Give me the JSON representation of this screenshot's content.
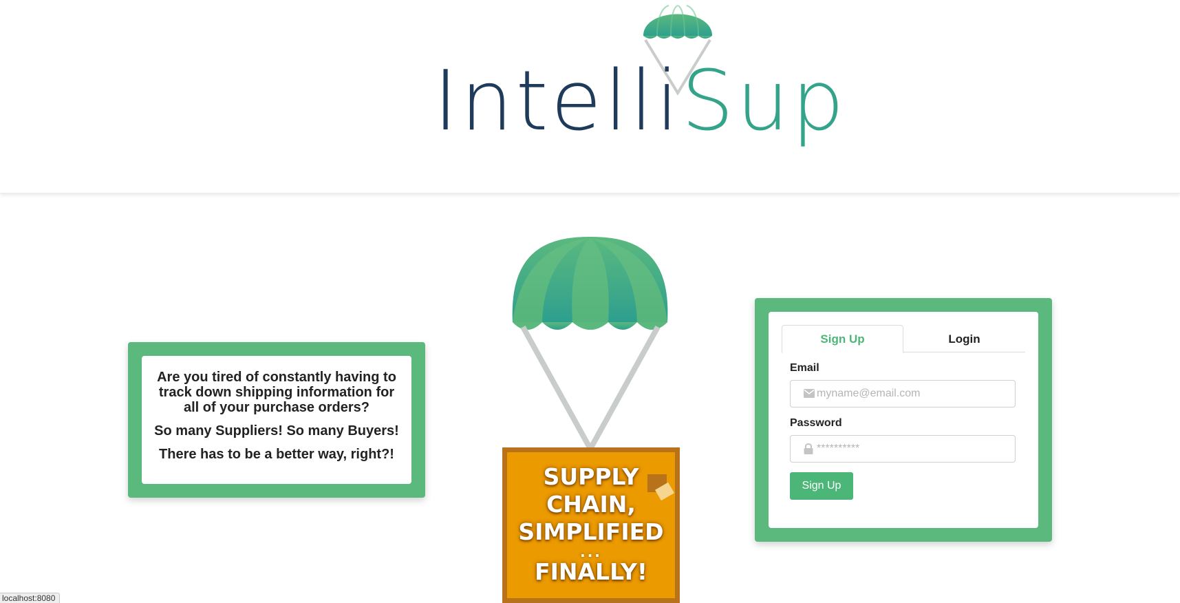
{
  "brand": {
    "logo_part1": "Intelli",
    "logo_part2": "Sup"
  },
  "info_card": {
    "line1": "Are you tired of constantly having to track down shipping information for all of your purchase orders?",
    "line2": "So many Suppliers! So many Buyers!",
    "line3": "There has to be a better way, right?!"
  },
  "hero": {
    "crate_line1": "SUPPLY",
    "crate_line2": "CHAIN,",
    "crate_line3": "SIMPLIFIED",
    "crate_dots": "...",
    "crate_line4": "FINALLY!"
  },
  "auth": {
    "tabs": [
      {
        "label": "Sign Up",
        "active": true
      },
      {
        "label": "Login",
        "active": false
      }
    ],
    "email_label": "Email",
    "email_placeholder": "myname@email.com",
    "email_icon": "envelope-icon",
    "password_label": "Password",
    "password_placeholder": "**********",
    "password_icon": "lock-icon",
    "submit_label": "Sign Up"
  },
  "status_bar": {
    "url": "localhost:8080"
  },
  "colors": {
    "brand_green": "#5bb97e",
    "button_green": "#4cb679",
    "logo_navy": "#1f3b5b",
    "logo_teal": "#33a48a",
    "crate_orange": "#eb9a00"
  }
}
